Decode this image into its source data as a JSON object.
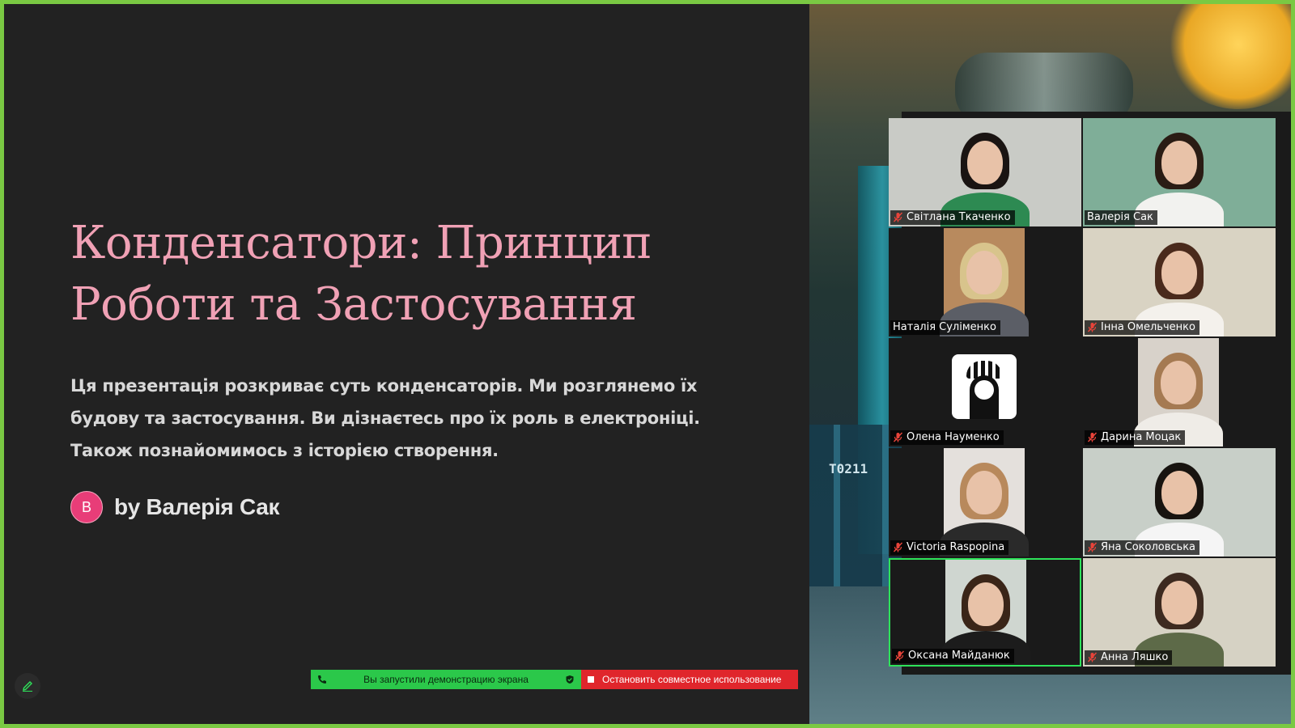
{
  "slide": {
    "title": "Конденсатори: Принцип Роботи та Застосування",
    "description": "Ця презентація розкриває суть конденсаторів. Ми розглянемо їх будову та застосування. Ви дізнаєтесь про їх роль в електроніці. Також познайомимось з історією створення.",
    "author_initial": "В",
    "author": "by Валерія Сак"
  },
  "share_bar": {
    "status": "Вы запустили демонстрацию экрана",
    "stop": "Остановить совместное использование"
  },
  "background": {
    "capacitor_label": "T0211"
  },
  "participants": [
    {
      "name": "Світлана Ткаченко",
      "muted": true,
      "video": "full",
      "bg": "#c9cbc6",
      "hair": "#1a1412",
      "body": "#2d8a52"
    },
    {
      "name": "Валерія Сак",
      "muted": false,
      "video": "full",
      "bg": "#7fae98",
      "hair": "#2a1c14",
      "body": "#f2f2ef"
    },
    {
      "name": "Наталія Суліменко",
      "muted": false,
      "video": "narrow",
      "bg": "#b88a5e",
      "hair": "#d8c48c",
      "body": "#5b5e66"
    },
    {
      "name": "Інна Омельченко",
      "muted": true,
      "video": "full",
      "bg": "#d9d3c3",
      "hair": "#4a2a1c",
      "body": "#f4f1ec"
    },
    {
      "name": "Олена Науменко",
      "muted": true,
      "video": "avatar",
      "bg": "#1a1a1a",
      "hair": "#111111",
      "body": "#ffffff"
    },
    {
      "name": "Дарина Моцак",
      "muted": true,
      "video": "narrow",
      "bg": "#d8d2ca",
      "hair": "#a57a52",
      "body": "#efece7"
    },
    {
      "name": "Victoria Raspopina",
      "muted": true,
      "video": "narrow",
      "bg": "#e4e0dc",
      "hair": "#b8895c",
      "body": "#2a2a2a"
    },
    {
      "name": "Яна Соколовська",
      "muted": true,
      "video": "full",
      "bg": "#c8cfc8",
      "hair": "#181410",
      "body": "#f5f5f5"
    },
    {
      "name": "Оксана Майданюк",
      "muted": true,
      "video": "narrow",
      "bg": "#cfd6d0",
      "hair": "#3a2518",
      "body": "#1c1c1c",
      "active": true
    },
    {
      "name": "Анна Ляшко",
      "muted": true,
      "video": "full",
      "bg": "#d6d2c4",
      "hair": "#3d2a20",
      "body": "#5d6a48"
    }
  ]
}
